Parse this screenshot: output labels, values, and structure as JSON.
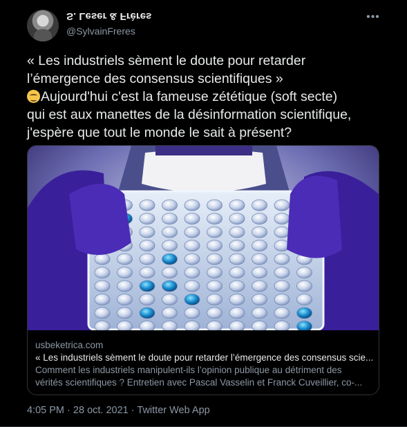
{
  "author": {
    "display_name": "S. Leser & Frères",
    "handle": "@SylvainFreres"
  },
  "more_icon": "more-horizontal-icon",
  "tweet_text": {
    "lines": [
      "« Les industriels sèment le doute pour retarder",
      "l’émergence des consensus scientifiques »",
      "Aujourd'hui c'est la fameuse zététique (soft secte)",
      "qui est aux manettes de la désinformation scientifique,",
      "j'espère que tout le monde le sait à présent?"
    ],
    "emoji": "smiling-face-with-smiling-eyes"
  },
  "link_card": {
    "image": "lab-researcher-holding-sample-plate",
    "domain": "usbeketrica.com",
    "title": "« Les industriels sèment le doute pour retarder l’émergence des consensus scie...",
    "description_lines": [
      "Comment les industriels manipulent-ils l’opinion publique au détriment des",
      "vérités scientifiques ? Entretien avec Pascal Vasselin et Franck Cuveillier, co-..."
    ]
  },
  "meta": {
    "time": "4:05 PM",
    "date": "28 oct. 2021",
    "source": "Twitter Web App",
    "separator": "·"
  },
  "colors": {
    "background": "#000000",
    "text": "#e7e9ea",
    "secondary": "#8b98a5",
    "border": "#2f3336"
  }
}
